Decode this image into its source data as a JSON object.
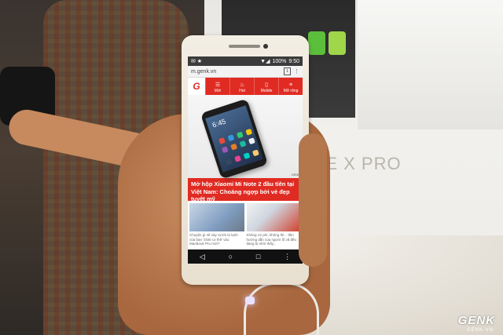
{
  "background": {
    "brand_text": "ME X PRO"
  },
  "phone": {
    "statusbar": {
      "left_icons": "✉ ★",
      "signal": "▼◢",
      "battery": "100%",
      "time": "9:50"
    },
    "browser": {
      "url": "m.genk.vn",
      "tab_count": "1",
      "menu": "⋮"
    },
    "site_nav": {
      "logo": "G",
      "items": [
        {
          "icon": "☰",
          "label": "Mới"
        },
        {
          "icon": "♨",
          "label": "Hot"
        },
        {
          "icon": "▯",
          "label": "Mobile"
        },
        {
          "icon": "≡",
          "label": "Mở rộng"
        }
      ]
    },
    "hero": {
      "mini_time": "6:45",
      "tag": "GENK"
    },
    "headline": "Mở hộp Xiaomi Mi Note 2 đầu tiên tại Việt Nam: Choáng ngợp bởi vẻ đẹp tuyệt mỹ",
    "cards": [
      {
        "text": "Chuyện gì sẽ xảy ra khi tủ lạnh của bạn '2GB cơ thể' vào MacBook Pro mới?"
      },
      {
        "text": "Không cứ phí, không thì... lắm hướng dẫn của người lỗ vã đều đang bị nhìn thấy..."
      }
    ],
    "softkeys": [
      "◁",
      "○",
      "□",
      "⋮"
    ]
  },
  "watermark": {
    "brand": "GENK",
    "sub": "GENK.VN"
  }
}
